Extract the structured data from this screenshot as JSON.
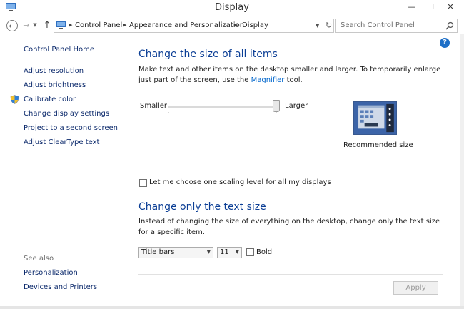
{
  "window": {
    "title": "Display",
    "minimize_label": "—",
    "maximize_label": "☐",
    "close_label": "✕"
  },
  "address": {
    "back_label": "←",
    "forward_label": "→",
    "recent_label": "▼",
    "up_label": "↑",
    "crumbs": [
      "Control Panel",
      "Appearance and Personalization",
      "Display"
    ],
    "dropdown_label": "▼",
    "refresh_label": "↻",
    "search_placeholder": "Search Control Panel"
  },
  "sidebar": {
    "home": "Control Panel Home",
    "items": [
      "Adjust resolution",
      "Adjust brightness",
      "Calibrate color",
      "Change display settings",
      "Project to a second screen",
      "Adjust ClearType text"
    ],
    "see_also": "See also",
    "see_also_items": [
      "Personalization",
      "Devices and Printers"
    ]
  },
  "help_label": "?",
  "main": {
    "heading1": "Change the size of all items",
    "para1_pre": "Make text and other items on the desktop smaller and larger. To temporarily enlarge just part of the screen, use the ",
    "para1_link": "Magnifier",
    "para1_post": " tool.",
    "slider_min_label": "Smaller",
    "slider_max_label": "Larger",
    "slider_value": 1.0,
    "preview_caption": "Recommended size",
    "scaling_checkbox_label": "Let me choose one scaling level for all my displays",
    "scaling_checkbox_checked": false,
    "heading2": "Change only the text size",
    "para2": "Instead of changing the size of everything on the desktop, change only the text size for a specific item.",
    "item_select": "Title bars",
    "size_select": "11",
    "bold_label": "Bold",
    "bold_checked": false,
    "apply_label": "Apply"
  },
  "colors": {
    "heading": "#0b3e95",
    "link": "#0c2a6c",
    "preview_blue": "#3c64a8"
  }
}
